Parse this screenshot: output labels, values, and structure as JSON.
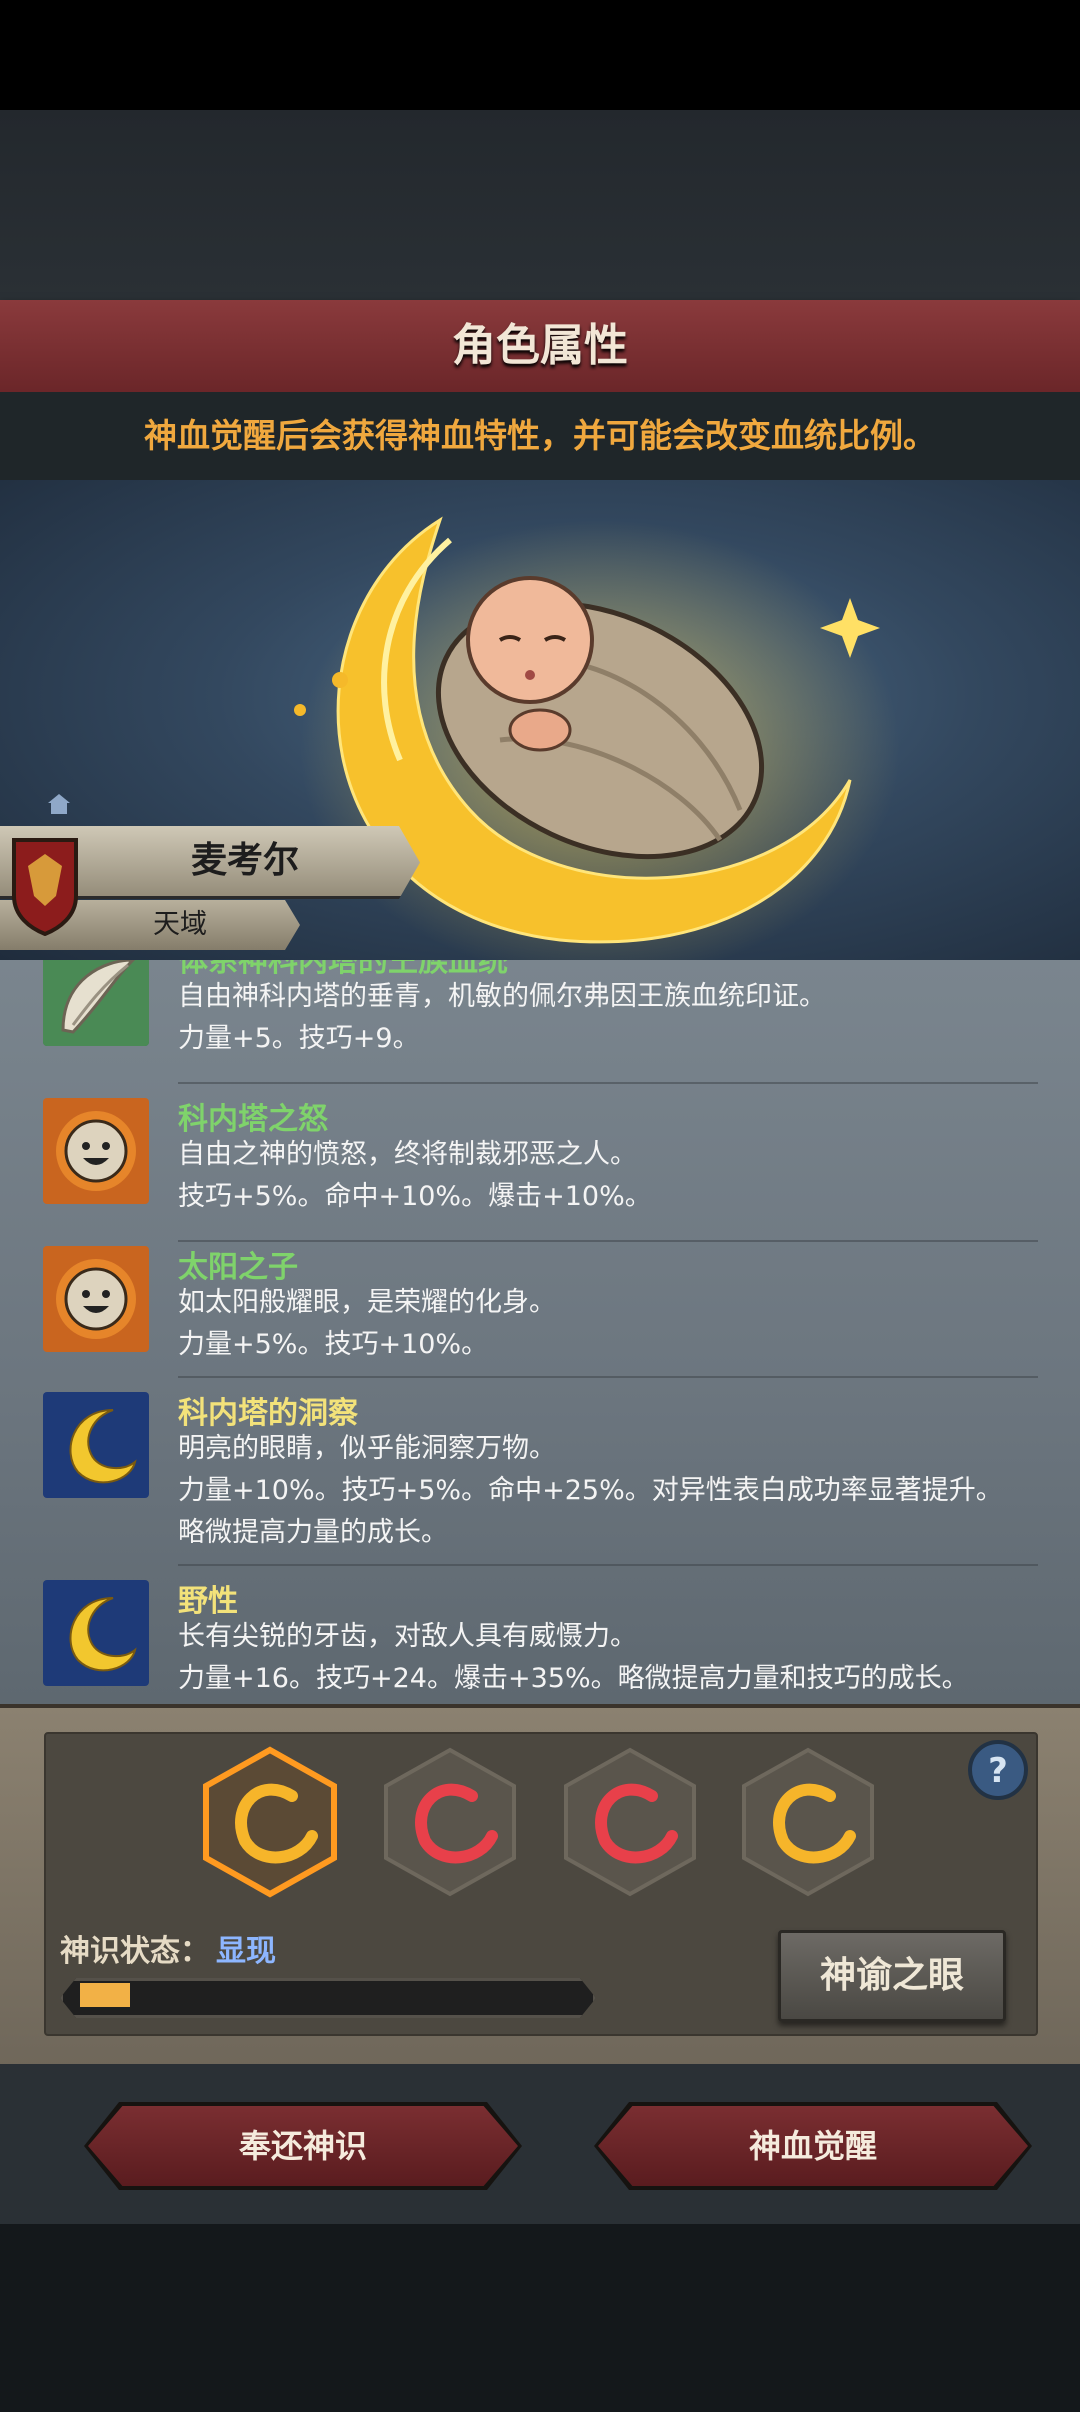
{
  "header": {
    "title": "角色属性",
    "subtitle": "神血觉醒后会获得神血特性，并可能会改变血统比例。"
  },
  "character": {
    "name": "麦考尔",
    "realm": "天域"
  },
  "traits": [
    {
      "name": "体系神科内塔的王族血统",
      "name_color": "#7fd36b",
      "description": "自由神科内塔的垂青，机敏的佩尔弗因王族血统印证。",
      "stats": "力量+5。技巧+9。",
      "icon": "white-feather-icon"
    },
    {
      "name": "科内塔之怒",
      "name_color": "#7fd36b",
      "description": "自由之神的愤怒，终将制裁邪恶之人。",
      "stats": "技巧+5%。命中+10%。爆击+10%。",
      "icon": "sun-face-icon"
    },
    {
      "name": "太阳之子",
      "name_color": "#7fd36b",
      "description": "如太阳般耀眼，是荣耀的化身。",
      "stats": "力量+5%。技巧+10%。",
      "icon": "sun-face-icon"
    },
    {
      "name": "科内塔的洞察",
      "name_color": "#f3e27a",
      "description": "明亮的眼睛，似乎能洞察万物。",
      "stats": "力量+10%。技巧+5%。命中+25%。对异性表白成功率显著提升。",
      "stats2": "略微提高力量的成长。",
      "icon": "golden-moon-icon"
    },
    {
      "name": "野性",
      "name_color": "#f3e27a",
      "description": "长有尖锐的牙齿，对敌人具有威慑力。",
      "stats": "力量+16。技巧+24。爆击+35%。略微提高力量和技巧的成长。",
      "icon": "golden-moon-icon"
    }
  ],
  "divine_slots": [
    {
      "icon": "gold-crescent-icon",
      "color": "#f6b52a",
      "selected": true
    },
    {
      "icon": "red-crescent-icon",
      "color": "#e8404a",
      "selected": false
    },
    {
      "icon": "red-crescent-icon",
      "color": "#e8404a",
      "selected": false
    },
    {
      "icon": "gold-crescent-icon",
      "color": "#f6b52a",
      "selected": false
    }
  ],
  "status": {
    "label": "神识状态：",
    "value": "显现",
    "progress": 0.1
  },
  "buttons": {
    "eye": "神谕之眼",
    "return": "奉还神识",
    "awaken": "神血觉醒"
  }
}
